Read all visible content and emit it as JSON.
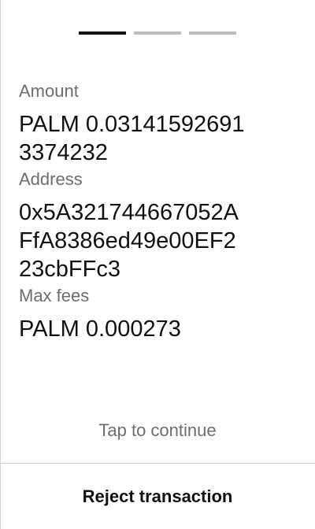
{
  "progress": {
    "steps": 3,
    "current": 1
  },
  "review": {
    "amount_label": "Amount",
    "amount_value_line1": "PALM 0.03141592691",
    "amount_value_line2": "3374232",
    "address_label": "Address",
    "address_value_line1": "0x5A321744667052A",
    "address_value_line2": "FfA8386ed49e00EF2",
    "address_value_line3": "23cbFFc3",
    "fees_label": "Max fees",
    "fees_value": "PALM 0.000273"
  },
  "actions": {
    "tap_hint": "Tap to continue",
    "reject_label": "Reject transaction"
  },
  "colors": {
    "text": "#111111",
    "muted": "#6d6d6d",
    "progress_active": "#111111",
    "progress_inactive": "#bdbdbd",
    "divider": "#cfcfcf"
  }
}
